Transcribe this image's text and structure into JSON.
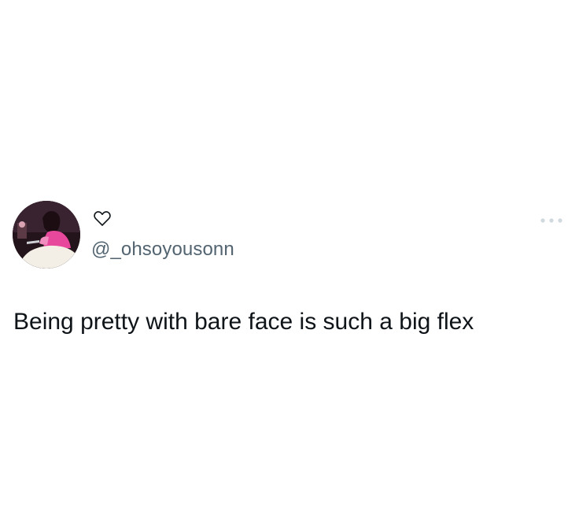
{
  "tweet": {
    "handle": "@_ohsoyousonn",
    "text": "Being pretty with bare face is such a big flex"
  },
  "icons": {
    "heart": "heart-outline-icon",
    "more": "more-horizontal-icon"
  },
  "colors": {
    "text_primary": "#0f1419",
    "text_secondary": "#536471",
    "more_dots": "#cfd9de",
    "avatar_shirt": "#e8489b"
  }
}
